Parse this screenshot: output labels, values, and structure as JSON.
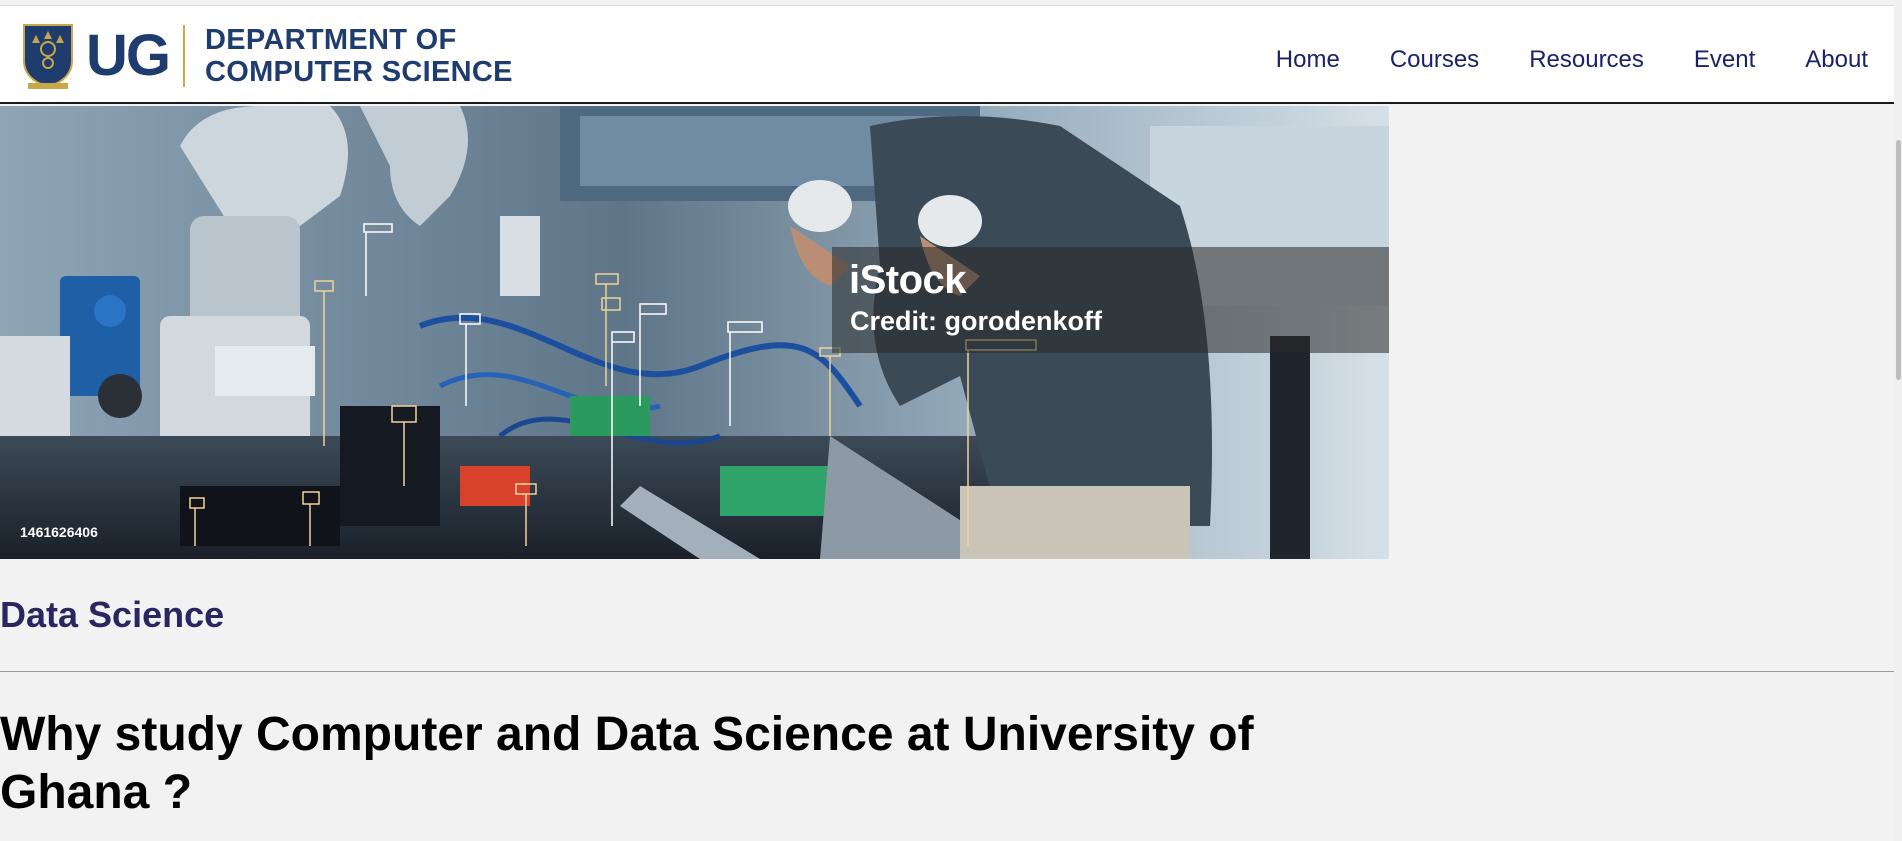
{
  "header": {
    "logo_text": "UG",
    "dept_line1": "DEPARTMENT OF",
    "dept_line2": "COMPUTER SCIENCE",
    "nav": [
      {
        "label": "Home"
      },
      {
        "label": "Courses"
      },
      {
        "label": "Resources"
      },
      {
        "label": "Event"
      },
      {
        "label": "About"
      }
    ]
  },
  "hero": {
    "watermark_logo": "iStock",
    "watermark_credit": "Credit: gorodenkoff",
    "stock_id": "1461626406"
  },
  "content": {
    "section_title": "Data Science",
    "heading": "Why study Computer and Data Science at University of Ghana ?"
  },
  "colors": {
    "brand": "#1f3c6e",
    "nav_text": "#1c2268",
    "section_title": "#2b2660",
    "background": "#f2f2f2"
  },
  "icons": {
    "crest": "ug-crest-icon"
  }
}
